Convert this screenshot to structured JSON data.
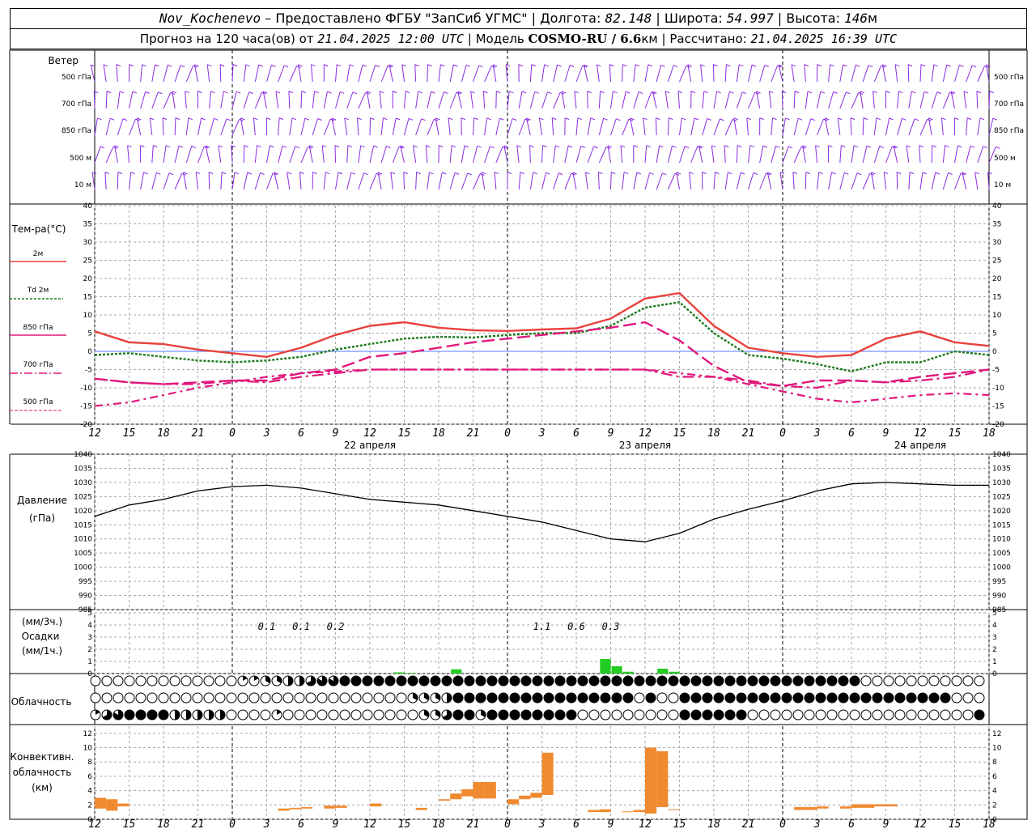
{
  "header": {
    "station": "Nov_Kochenevo",
    "provider": "– Предоставлено ФГБУ \"ЗапСиб УГМС\"",
    "lon_label": "Долгота:",
    "lon": "82.148",
    "lat_label": "Широта:",
    "lat": "54.997",
    "alt_label": "Высота:",
    "alt": "146",
    "alt_unit": "м",
    "forecast_label": "Прогноз на 120 часа(ов) от",
    "forecast_from": "21.04.2025 12:00 UTC",
    "model_label": "Модель",
    "model": "COSMO-RU / 6.6",
    "model_unit": "км",
    "calc_label": "Рассчитано:",
    "calc_time": "21.04.2025 16:39 UTC"
  },
  "wind": {
    "title": "Ветер",
    "levels": [
      "500 гПа",
      "700 гПа",
      "850 гПа",
      "500 м",
      "10  м"
    ],
    "color": "#8a2be2"
  },
  "temperature": {
    "title": "Тем-ра(°С)",
    "legend": [
      {
        "label": "2м",
        "color": "#e8413c"
      },
      {
        "label": "Td 2м",
        "color": "#1a7a1a"
      },
      {
        "label": "850 гПа",
        "color": "#e0187c"
      },
      {
        "label": "700 гПа",
        "color": "#e0187c"
      },
      {
        "label": "500 гПа",
        "color": "#e0187c"
      }
    ],
    "ylim": [
      -20,
      40
    ]
  },
  "pressure": {
    "title": "Давление",
    "unit": "(гПа)",
    "ylim": [
      985,
      1040
    ]
  },
  "precip": {
    "title1": "(мм/3ч.)",
    "title2": "Осадки",
    "title3": "(мм/1ч.)",
    "ylim": [
      0,
      5
    ],
    "totals": [
      {
        "hour": 15,
        "text": "0.1"
      },
      {
        "hour": 18,
        "text": "0.1"
      },
      {
        "hour": 21,
        "text": "0.2"
      },
      {
        "hour": 39,
        "text": "1.1"
      },
      {
        "hour": 42,
        "text": "0.6"
      },
      {
        "hour": 45,
        "text": "0.3"
      }
    ],
    "bar_color": "#22cc22"
  },
  "cloud": {
    "title": "Облачность"
  },
  "convective": {
    "title1": "Конвективн.",
    "title2": "облачность",
    "title3": "(км)",
    "ylim": [
      0,
      13
    ],
    "bar_color": "#f08a30"
  },
  "x_axis": {
    "tick_labels": [
      "12",
      "15",
      "18",
      "21",
      "0",
      "3",
      "6",
      "9",
      "12",
      "15",
      "18",
      "21",
      "0",
      "3",
      "6",
      "9",
      "12",
      "15",
      "18",
      "21",
      "0",
      "3",
      "6",
      "9",
      "12",
      "15",
      "18"
    ],
    "day_labels": [
      {
        "hour": 24,
        "text": "22 апреля"
      },
      {
        "hour": 48,
        "text": "23 апреля"
      },
      {
        "hour": 72,
        "text": "24 апреля"
      }
    ]
  },
  "chart_data": [
    {
      "type": "line",
      "title": "Тем-ра(°С)",
      "x_unit": "hours since 21.04.2025 12:00 UTC",
      "ylim": [
        -20,
        40
      ],
      "series": [
        {
          "name": "2м",
          "x": [
            0,
            3,
            6,
            9,
            12,
            15,
            18,
            21,
            24,
            27,
            30,
            33,
            36,
            39,
            42,
            45,
            48,
            51,
            54,
            57,
            60,
            63,
            66,
            69,
            72,
            75,
            78
          ],
          "values": [
            5.5,
            2.5,
            2,
            0.5,
            -0.5,
            -1.5,
            1,
            4.5,
            7,
            8,
            6.5,
            5.8,
            5.6,
            6,
            6.3,
            9,
            14.5,
            16,
            7,
            1,
            -0.5,
            -1.5,
            -1,
            3.5,
            5.5,
            2.5,
            1.5
          ]
        },
        {
          "name": "Td 2м",
          "x": [
            0,
            3,
            6,
            9,
            12,
            15,
            18,
            21,
            24,
            27,
            30,
            33,
            36,
            39,
            42,
            45,
            48,
            51,
            54,
            57,
            60,
            63,
            66,
            69,
            72,
            75,
            78
          ],
          "values": [
            -1,
            -0.5,
            -1.5,
            -2.5,
            -3,
            -2.5,
            -1.5,
            0.5,
            2,
            3.5,
            4,
            3.8,
            4.5,
            5,
            5,
            7,
            12,
            13.5,
            5,
            -1,
            -2,
            -3.5,
            -5.5,
            -3,
            -3,
            0,
            -1
          ]
        },
        {
          "name": "850 гПа",
          "x": [
            0,
            3,
            6,
            9,
            12,
            15,
            18,
            21,
            24,
            27,
            30,
            33,
            36,
            39,
            42,
            45,
            48,
            51,
            54,
            57,
            60,
            63,
            66,
            69,
            72,
            75,
            78
          ],
          "values": [
            -7.5,
            -8.5,
            -9,
            -8.5,
            -8,
            -8,
            -6,
            -5,
            -1.5,
            -0.5,
            1,
            2.5,
            3.5,
            4.5,
            5.5,
            6.5,
            8,
            3,
            -4,
            -8.5,
            -9.5,
            -8,
            -8,
            -8.5,
            -7,
            -6,
            -5
          ]
        },
        {
          "name": "700 гПа",
          "x": [
            0,
            3,
            6,
            9,
            12,
            15,
            18,
            21,
            24,
            27,
            30,
            33,
            36,
            39,
            42,
            45,
            48,
            51,
            54,
            57,
            60,
            63,
            66,
            69,
            72,
            75,
            78
          ],
          "values": [
            -7.5,
            -8.5,
            -9,
            -9,
            -8,
            -8.5,
            -7,
            -6,
            -5,
            -5,
            -5,
            -5,
            -5,
            -5,
            -5,
            -5,
            -5,
            -7,
            -7,
            -8,
            -9.5,
            -10,
            -8,
            -8.5,
            -8,
            -7,
            -5
          ]
        },
        {
          "name": "500 гПа",
          "x": [
            0,
            3,
            6,
            9,
            12,
            15,
            18,
            21,
            24,
            27,
            30,
            33,
            36,
            39,
            42,
            45,
            48,
            51,
            54,
            57,
            60,
            63,
            66,
            69,
            72,
            75,
            78
          ],
          "values": [
            -15,
            -14,
            -12,
            -10,
            -8.5,
            -7,
            -6,
            -5.5,
            -5,
            -5,
            -5,
            -5,
            -5,
            -5,
            -5,
            -5,
            -5,
            -6,
            -7,
            -9,
            -11,
            -13,
            -14,
            -13,
            -12,
            -11.5,
            -12
          ]
        }
      ]
    },
    {
      "type": "line",
      "title": "Давление",
      "x_unit": "hours since 21.04.2025 12:00 UTC",
      "ylim": [
        985,
        1040
      ],
      "series": [
        {
          "name": "Давление",
          "x": [
            0,
            3,
            6,
            9,
            12,
            15,
            18,
            21,
            24,
            27,
            30,
            33,
            36,
            39,
            42,
            45,
            48,
            51,
            54,
            57,
            60,
            63,
            66,
            69,
            72,
            75,
            78
          ],
          "values": [
            1018,
            1022,
            1024,
            1027,
            1028.5,
            1029,
            1028,
            1026,
            1024,
            1023,
            1022,
            1020,
            1018,
            1016,
            1013,
            1010,
            1009,
            1012,
            1017,
            1020.5,
            1023.5,
            1027,
            1029.5,
            1030,
            1029.5,
            1029,
            1029
          ]
        }
      ]
    },
    {
      "type": "bar",
      "title": "Осадки",
      "x_unit": "hours since 21.04.2025 12:00 UTC",
      "ylim": [
        0,
        5
      ],
      "series": [
        {
          "name": "Осадки",
          "x": [
            26,
            27,
            31,
            44,
            45,
            46,
            49,
            50
          ],
          "values": [
            0.1,
            0.05,
            0.35,
            1.2,
            0.6,
            0.15,
            0.4,
            0.15
          ]
        }
      ]
    },
    {
      "type": "bar",
      "title": "Конвективн. облачность",
      "x_unit": "hours since 21.04.2025 12:00 UTC",
      "ylim": [
        0,
        13
      ],
      "series": [
        {
          "name": "Конвективн. облачность",
          "x": [
            0,
            1,
            2,
            16,
            17,
            18,
            20,
            21,
            24,
            28,
            30,
            31,
            32,
            33,
            34,
            36,
            37,
            38,
            39,
            43,
            44,
            46,
            47,
            48,
            49,
            50,
            61,
            62,
            63,
            65,
            66,
            67,
            68,
            69
          ],
          "y0": [
            1.5,
            1.2,
            1.8,
            1.2,
            1.4,
            1.5,
            1.5,
            1.6,
            1.8,
            1.3,
            2.6,
            2.8,
            3.2,
            2.9,
            2.9,
            2.1,
            2.8,
            3,
            3.4,
            1,
            1,
            1,
            1,
            0.8,
            1.7,
            1.3,
            1.3,
            1.3,
            1.5,
            1.5,
            1.6,
            1.6,
            1.8,
            1.8
          ],
          "y1": [
            3,
            2.8,
            2.2,
            1.5,
            1.6,
            1.7,
            1.9,
            1.9,
            2.2,
            1.6,
            2.8,
            3.6,
            4.2,
            5.2,
            5.2,
            2.8,
            3.3,
            3.7,
            9.3,
            1.3,
            1.4,
            1.1,
            1.3,
            10,
            9.5,
            1.4,
            1.7,
            1.7,
            1.8,
            1.8,
            2.1,
            2.1,
            2.1,
            2.1
          ]
        }
      ]
    }
  ]
}
